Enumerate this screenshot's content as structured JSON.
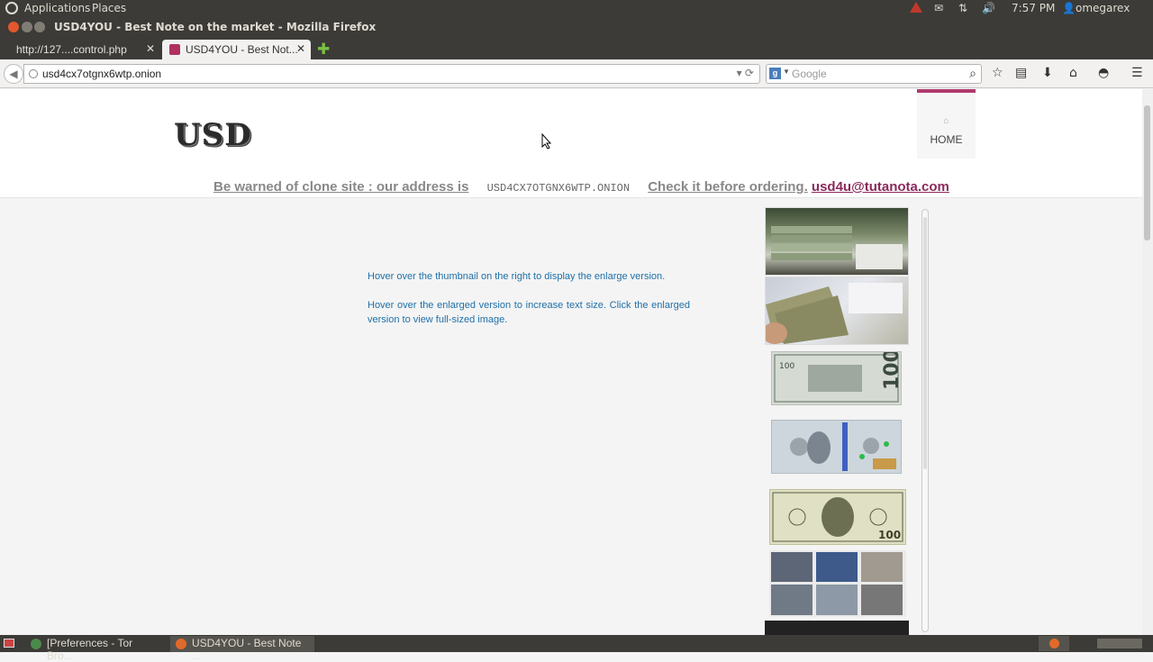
{
  "top_panel": {
    "applications": "Applications",
    "places": "Places",
    "clock": "7:57 PM",
    "user": "omegarex"
  },
  "window": {
    "title": "USD4YOU - Best Note on the market - Mozilla Firefox"
  },
  "tabs": [
    {
      "label": "http://127....control.php",
      "active": false
    },
    {
      "label": "USD4YOU - Best Not...",
      "active": true
    }
  ],
  "nav": {
    "url": "usd4cx7otgnx6wtp.onion",
    "search_placeholder": "Google"
  },
  "page": {
    "logo_text": "USD",
    "home_label": "HOME",
    "warning_text": "Be warned of clone site : our address is",
    "onion_address": "USD4CX7OTGNX6WTP.ONION",
    "check_text": "Check it before ordering.",
    "email": "usd4u@tutanota.com",
    "instruction_1": "Hover over the thumbnail on the right to display the enlarge version.",
    "instruction_2": "Hover over the enlarged version to increase text size. Click the enlarged version to view full-sized image."
  },
  "taskbar": {
    "items": [
      {
        "label": "[Preferences - Tor Bro...",
        "active": false
      },
      {
        "label": "USD4YOU - Best Note ...",
        "active": true
      }
    ]
  },
  "colors": {
    "accent": "#b03a6d",
    "link": "#2070a8",
    "panel": "#3c3b37"
  }
}
